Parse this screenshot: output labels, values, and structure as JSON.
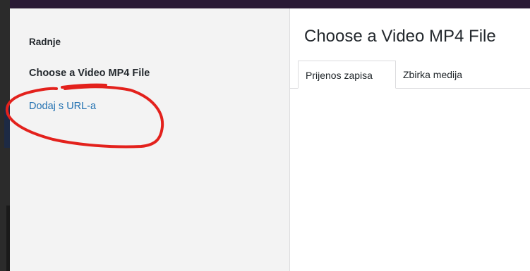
{
  "sidebar": {
    "heading": "Radnje",
    "active_item": "Choose a Video MP4 File",
    "link_item": "Dodaj s URL-a"
  },
  "main": {
    "title": "Choose a Video MP4 File",
    "tabs": [
      {
        "label": "Prijenos zapisa",
        "active": true
      },
      {
        "label": "Zbirka medija",
        "active": false
      }
    ]
  },
  "colors": {
    "link": "#2271b1",
    "annotation": "#e3211c",
    "sidebar_bg": "#f3f3f3"
  }
}
